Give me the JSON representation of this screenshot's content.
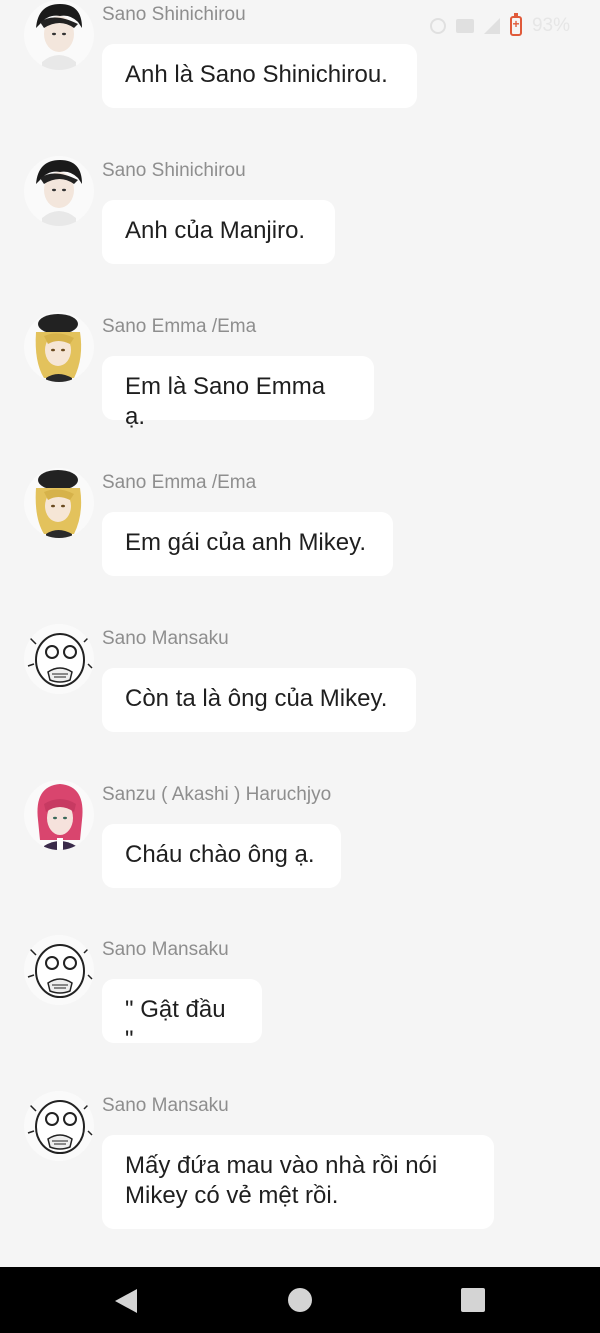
{
  "status": {
    "battery_text": "93%"
  },
  "messages": [
    {
      "sender": "Sano Shinichirou",
      "text": "Anh là Sano Shinichirou.",
      "avatar": "shinichirou"
    },
    {
      "sender": "Sano Shinichirou",
      "text": "Anh của Manjiro.",
      "avatar": "shinichirou"
    },
    {
      "sender": "Sano Emma /Ema",
      "text": "Em là Sano Emma ạ.",
      "avatar": "emma"
    },
    {
      "sender": "Sano Emma /Ema",
      "text": "Em gái của anh Mikey.",
      "avatar": "emma"
    },
    {
      "sender": "Sano Mansaku",
      "text": "Còn ta là ông của Mikey.",
      "avatar": "mansaku"
    },
    {
      "sender": "Sanzu ( Akashi ) Haruchjyo",
      "text": "Cháu chào ông ạ.",
      "avatar": "sanzu"
    },
    {
      "sender": "Sano Mansaku",
      "text": "\" Gật đầu \"",
      "avatar": "mansaku"
    },
    {
      "sender": "Sano Mansaku",
      "text": "Mấy đứa mau vào nhà rồi nói\nMikey có vẻ mệt rồi.",
      "avatar": "mansaku"
    }
  ],
  "nav": {
    "back": "back-icon",
    "home": "home-icon",
    "recent": "recent-apps-icon"
  },
  "colors": {
    "background": "#f5f5f5",
    "bubble": "#ffffff",
    "sender": "#8e8e8e",
    "battery": "#e05a3a"
  }
}
